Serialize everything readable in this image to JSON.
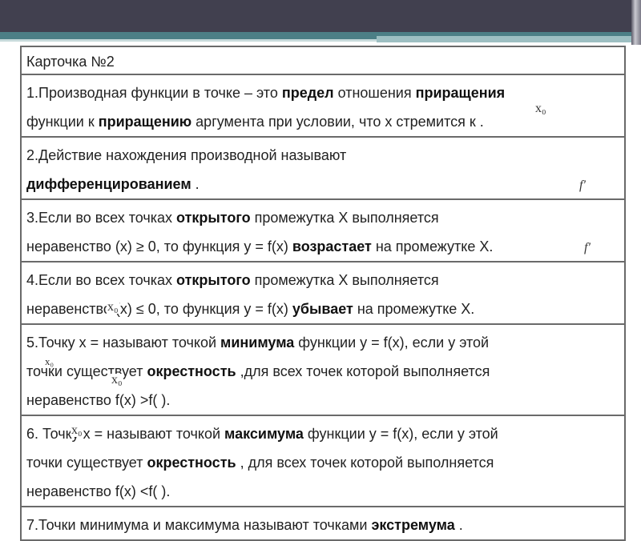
{
  "card_title": "Карточка №2",
  "rows": [
    {
      "lines": [
        [
          {
            "t": "1.Производная функции в точке – это "
          },
          {
            "t": "предел",
            "b": true
          },
          {
            "t": " отношения "
          },
          {
            "t": "приращения",
            "b": true
          }
        ],
        [
          {
            "t": "функции к  "
          },
          {
            "t": "приращению",
            "b": true
          },
          {
            "t": " аргумента при условии, что х стремится к     ."
          }
        ]
      ]
    },
    {
      "lines": [
        [
          {
            "t": "2.Действие нахождения производной называют"
          }
        ],
        [
          {
            "t": "дифференцированием",
            "b": true
          },
          {
            "t": " ."
          }
        ]
      ]
    },
    {
      "lines": [
        [
          {
            "t": "3.Если во всех точках "
          },
          {
            "t": "открытого",
            "b": true
          },
          {
            "t": " промежутка Х выполняется"
          }
        ],
        [
          {
            "t": "неравенство    (х) ≥ 0, то функция у = f(x) "
          },
          {
            "t": "возрастает",
            "b": true
          },
          {
            "t": " на промежутке Х."
          }
        ]
      ]
    },
    {
      "lines": [
        [
          {
            "t": "4.Если во всех точках "
          },
          {
            "t": "открытого",
            "b": true
          },
          {
            "t": " промежутка Х выполняется"
          }
        ],
        [
          {
            "t": "неравенство     (х) ≤ 0, то функция у = f(x) "
          },
          {
            "t": "убывает",
            "b": true
          },
          {
            "t": " на промежутке Х."
          }
        ]
      ]
    },
    {
      "lines": [
        [
          {
            "t": "5.Точку х =     называют точкой "
          },
          {
            "t": "минимума",
            "b": true
          },
          {
            "t": " функции у = f(x), если у этой"
          }
        ],
        [
          {
            "t": "точки существует "
          },
          {
            "t": "окрестность",
            "b": true
          },
          {
            "t": " ,для всех точек которой выполняется"
          }
        ],
        [
          {
            "t": "неравенство f(x) >f(   )."
          }
        ]
      ]
    },
    {
      "lines": [
        [
          {
            "t": "6. Точку х =     называют точкой "
          },
          {
            "t": "максимума",
            "b": true
          },
          {
            "t": " функции у = f(x), если у этой"
          }
        ],
        [
          {
            "t": "точки существует "
          },
          {
            "t": "окрестность",
            "b": true
          },
          {
            "t": " , для всех точек которой выполняется"
          }
        ],
        [
          {
            "t": "неравенство f(x) <f(   )."
          }
        ]
      ]
    },
    {
      "lines": [
        [
          {
            "t": "7.Точки минимума и максимума называют точками "
          },
          {
            "t": "экстремума",
            "b": true
          },
          {
            "t": " ."
          }
        ]
      ]
    }
  ],
  "math": {
    "x0": "x₀",
    "fprime": "f′"
  }
}
